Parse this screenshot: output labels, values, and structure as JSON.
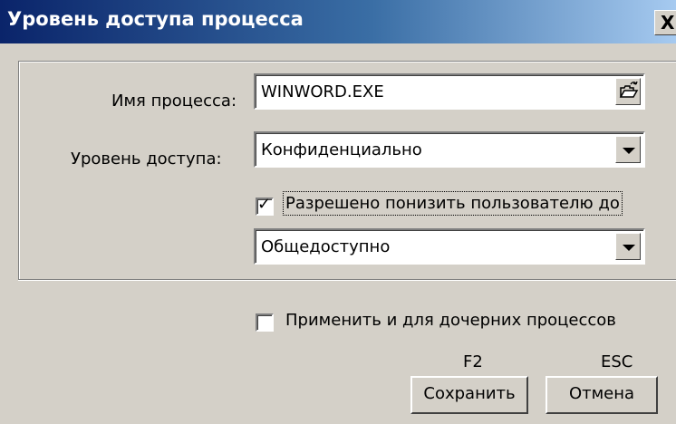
{
  "window": {
    "title": "Уровень доступа процесса",
    "close_label": "X"
  },
  "process": {
    "label": "Имя процесса:",
    "value": "WINWORD.EXE",
    "browse_icon": "folder-open-icon"
  },
  "access": {
    "label": "Уровень доступа:",
    "value": "Конфиденциально"
  },
  "lower": {
    "label": "Разрешено понизить пользователю до",
    "checked": true,
    "value": "Общедоступно"
  },
  "children": {
    "label": "Применить и для дочерних процессов",
    "checked": false
  },
  "buttons": {
    "save_hotkey": "F2",
    "save_label": "Сохранить",
    "cancel_hotkey": "ESC",
    "cancel_label": "Отмена"
  }
}
